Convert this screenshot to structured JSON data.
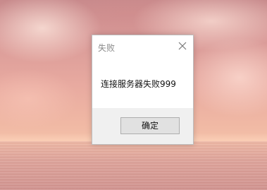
{
  "dialog": {
    "title": "失败",
    "message": "连接服务器失败999",
    "ok_label": "确定"
  },
  "icons": {
    "close": "close-icon"
  },
  "colors": {
    "dialog_bg": "#ffffff",
    "footer_bg": "#f0f0f0",
    "button_bg": "#e1e1e1",
    "title_text": "#8a8a8a"
  }
}
